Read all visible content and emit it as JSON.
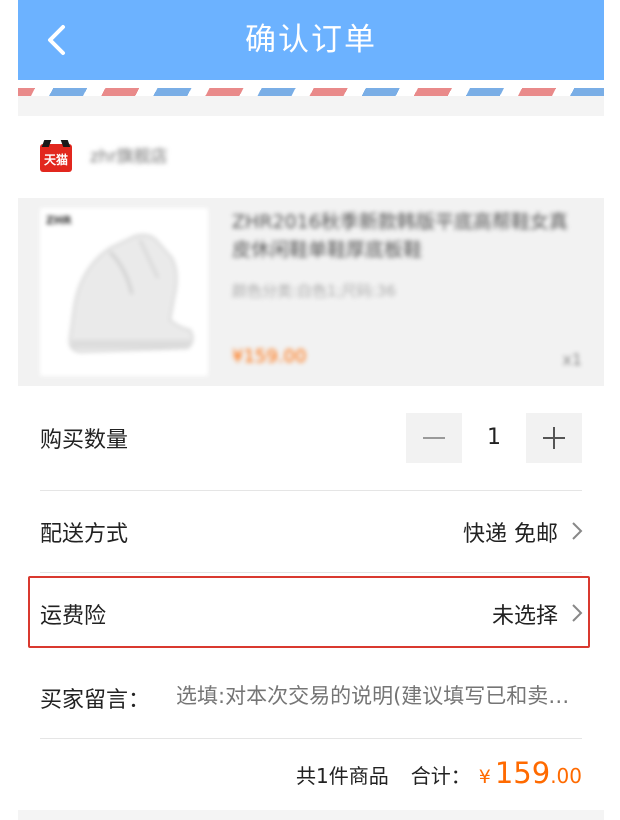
{
  "header": {
    "title": "确认订单",
    "back_icon": "chevron-left-icon"
  },
  "shop": {
    "badge": "天猫",
    "name": "zhr旗舰店"
  },
  "product": {
    "brand": "ZHR",
    "title": "ZHR2016秋季新款韩版平底高帮鞋女真皮休闲鞋单鞋厚底板鞋",
    "spec": "颜色分类:白色1;尺码:36",
    "price": "¥159.00",
    "quantity": "x1"
  },
  "quantity_row": {
    "label": "购买数量",
    "value": "1",
    "minus": "−",
    "plus": "+"
  },
  "shipping_row": {
    "label": "配送方式",
    "value": "快递 免邮"
  },
  "insurance_row": {
    "label": "运费险",
    "value": "未选择"
  },
  "message_row": {
    "label": "买家留言：",
    "placeholder": "选填:对本次交易的说明(建议填写已和卖家协商一致的内容)"
  },
  "summary": {
    "count": "共1件商品",
    "total_label": "合计：",
    "currency": "¥",
    "amount_int": "159",
    "amount_dec": ".00"
  },
  "colors": {
    "header": "#6cb2ff",
    "price": "#ff6a00",
    "highlight": "#d9392f"
  }
}
